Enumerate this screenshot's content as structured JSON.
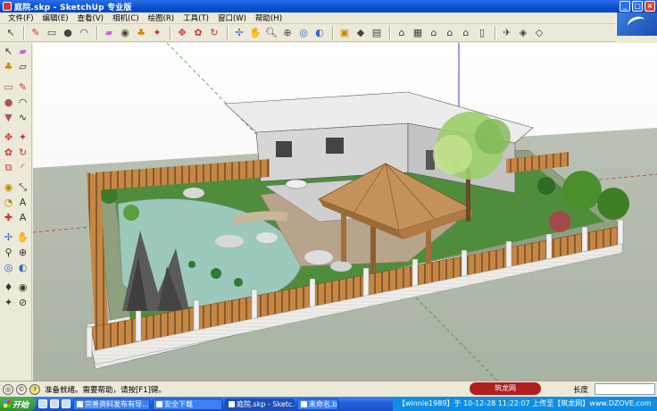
{
  "window": {
    "title": "庭院.skp - SketchUp 专业版",
    "buttons": [
      "_",
      "□",
      "×"
    ]
  },
  "menubar": {
    "items": [
      "文件(F)",
      "编辑(E)",
      "查看(V)",
      "相机(C)",
      "绘图(R)",
      "工具(T)",
      "窗口(W)",
      "帮助(H)"
    ]
  },
  "toolbar": {
    "icons": [
      "select-arrow",
      "pencil",
      "rectangle",
      "circle",
      "arc",
      "eraser",
      "tape-measure",
      "paint-bucket",
      "push-pull",
      "move",
      "rotate",
      "follow-me",
      "offset",
      "orbit",
      "pan",
      "zoom",
      "zoom-window",
      "zoom-extents",
      "previous",
      "next",
      "iso-view",
      "top-view",
      "front-view",
      "right-view",
      "back-view",
      "left-view",
      "section",
      "components",
      "materials"
    ]
  },
  "status": {
    "text": "准备就绪。需要帮助，请按[F1]键。",
    "length_label": "长度",
    "length_value": ""
  },
  "watermark": {
    "text": "【winnie1989】于 10-12-28 11:22:07 上传至【筑龙网】www.DZOVE.com",
    "badge": "筑龙网"
  },
  "taskbar": {
    "start_label": "开始",
    "tasks": [
      {
        "label": "完善资料发布有导...",
        "active": false
      },
      {
        "label": "安全下载",
        "active": false
      },
      {
        "label": "庭院.skp - Sketc...",
        "active": true
      },
      {
        "label": "未命名.bmp",
        "active": false
      }
    ]
  },
  "colors": {
    "ground": "#c4ccbf",
    "grass": "#4c8a3a",
    "water": "#9ac8b8",
    "fence": "#b97a3d",
    "wall": "#d9d9d9",
    "roof": "#e8e8e8",
    "pavilion": "#b07a44"
  }
}
